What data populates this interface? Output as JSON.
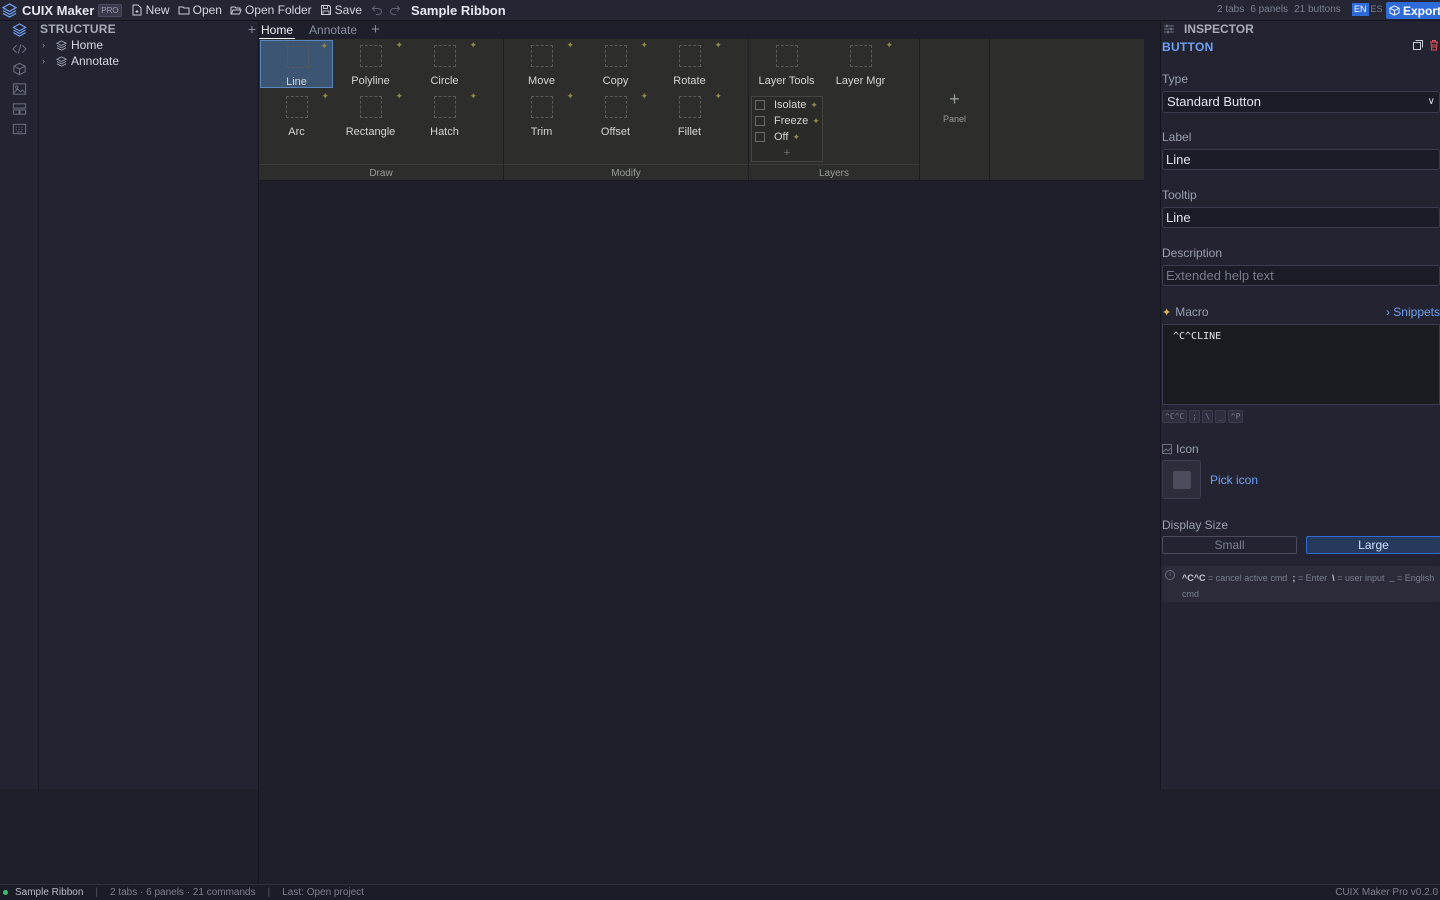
{
  "topbar": {
    "app_title": "CUIX Maker",
    "pro_badge": "PRO",
    "buttons": {
      "new": "New",
      "open": "Open",
      "open_folder": "Open Folder",
      "save": "Save"
    },
    "document_title": "Sample Ribbon",
    "stats": {
      "tabs": "2 tabs",
      "panels": "6 panels",
      "buttons": "21 buttons"
    },
    "lang": {
      "active": "EN",
      "other": "ES"
    },
    "export": "Export"
  },
  "structure": {
    "title": "STRUCTURE",
    "add": "+",
    "items": [
      {
        "label": "Home"
      },
      {
        "label": "Annotate"
      }
    ]
  },
  "ribbon": {
    "tabs": [
      {
        "label": "Home"
      },
      {
        "label": "Annotate"
      }
    ],
    "add_tab": "+",
    "panels": {
      "draw": {
        "label": "Draw",
        "buttons": [
          "Line",
          "Polyline",
          "Circle",
          "Arc",
          "Rectangle",
          "Hatch"
        ]
      },
      "modify": {
        "label": "Modify",
        "buttons": [
          "Move",
          "Copy",
          "Rotate",
          "Trim",
          "Offset",
          "Fillet"
        ]
      },
      "layers": {
        "label": "Layers",
        "buttons": [
          "Layer Tools",
          "Layer Mgr"
        ],
        "dropdown": [
          "Isolate",
          "Freeze",
          "Off"
        ],
        "dropdown_add": "+"
      }
    },
    "add_panel": {
      "plus": "+",
      "label": "Panel"
    }
  },
  "inspector": {
    "title": "INSPECTOR",
    "kind": "BUTTON",
    "type": {
      "label": "Type",
      "value": "Standard Button"
    },
    "label_field": {
      "label": "Label",
      "value": "Line"
    },
    "tooltip": {
      "label": "Tooltip",
      "value": "Line"
    },
    "description": {
      "label": "Description",
      "placeholder": "Extended help text"
    },
    "macro": {
      "label": "Macro",
      "snippets": "Snippets",
      "value": "^C^CLINE"
    },
    "chips": [
      "^C^C",
      ";",
      "\\",
      "_",
      "^P"
    ],
    "icon": {
      "label": "Icon",
      "pick": "Pick icon"
    },
    "display_size": {
      "label": "Display Size",
      "small": "Small",
      "large": "Large",
      "selected": "Large"
    },
    "info": {
      "k1": "^C^C",
      "v1": "= cancel active cmd",
      "k2": ";",
      "v2": "= Enter",
      "k3": "\\",
      "v3": "= user input",
      "k4": "_",
      "v4": "= English cmd"
    }
  },
  "statusbar": {
    "project": "Sample Ribbon",
    "counts": "2 tabs · 6 panels · 21 commands",
    "last": "Last: Open project",
    "version": "CUIX Maker Pro v0.2.0"
  },
  "colors": {
    "accent": "#2f6ad9",
    "link": "#6ea2f5",
    "ribbon_bg": "#2d2d2b",
    "status_ok": "#3bbf6a",
    "delete": "#e05555"
  }
}
